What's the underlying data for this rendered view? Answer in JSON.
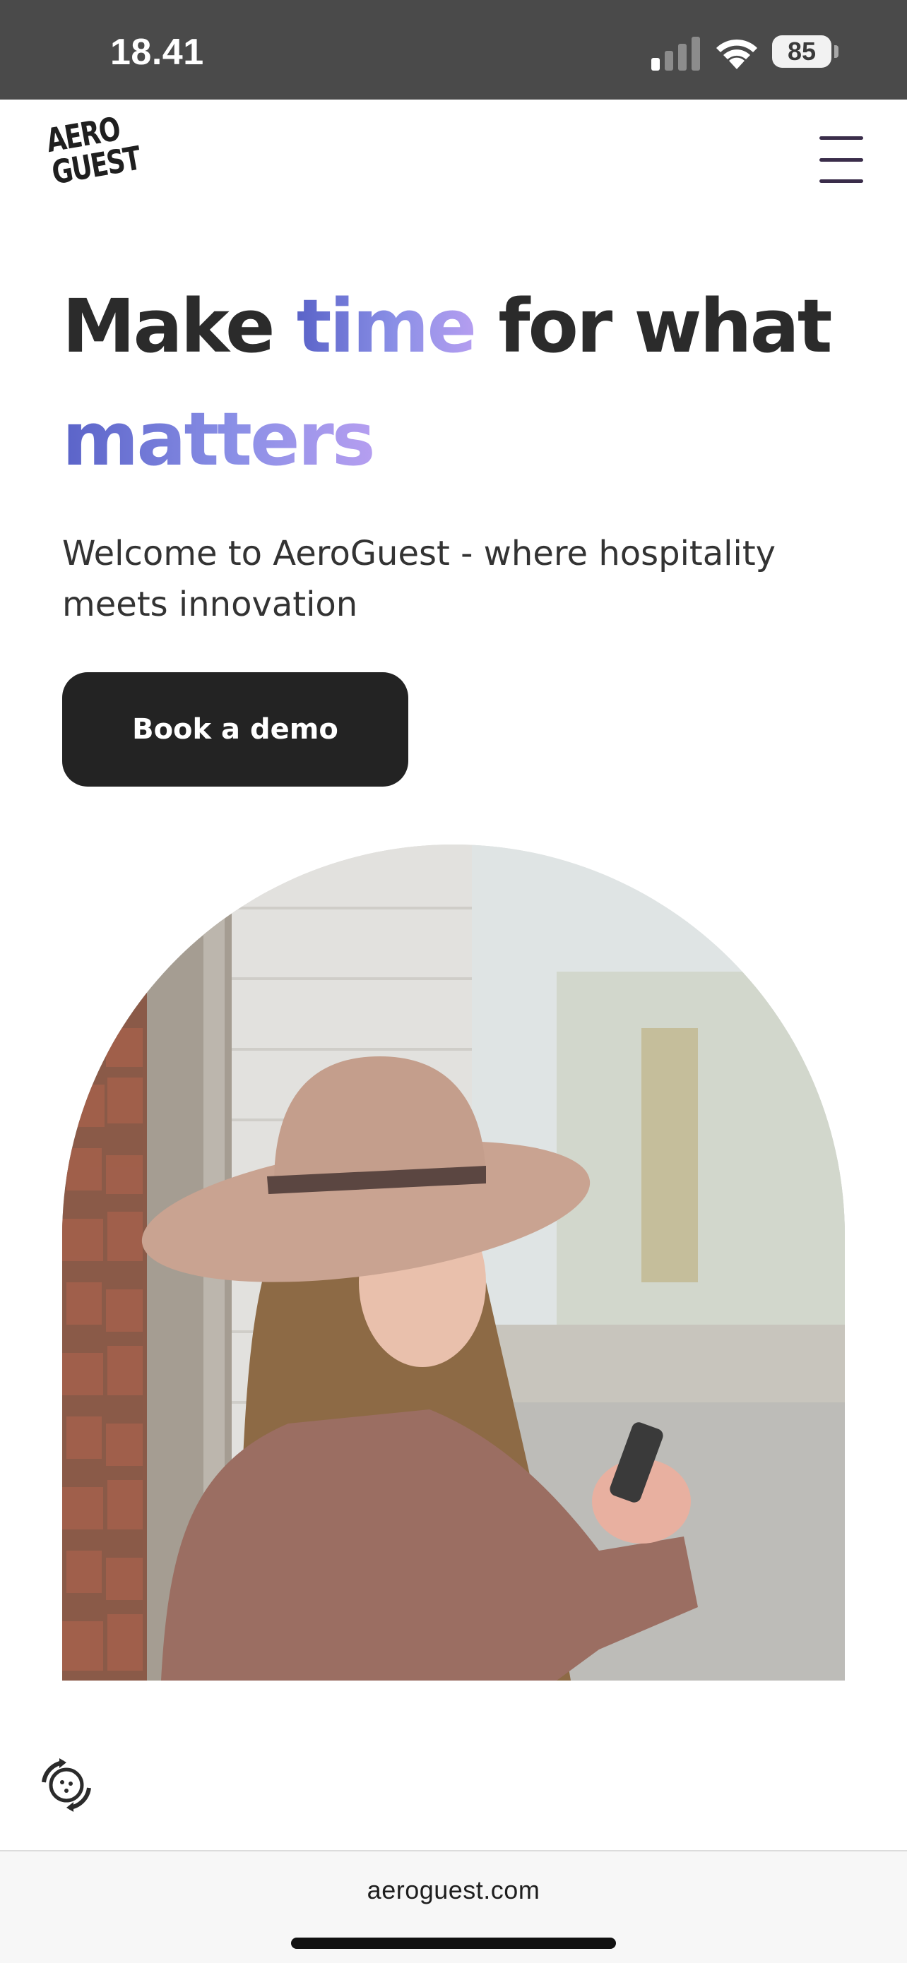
{
  "status_bar": {
    "time": "18.41",
    "battery_level": "85",
    "signal_bars_active": 1,
    "signal_bars_total": 4
  },
  "header": {
    "logo_line1": "AERO",
    "logo_line2": "GUEST",
    "menu_icon": "hamburger-menu-icon"
  },
  "hero": {
    "title_part1": "Make ",
    "title_highlight1": "time",
    "title_part2": " for what",
    "title_highlight2": "matters",
    "subtitle": "Welcome to AeroGuest - where hospitality meets innovation",
    "cta_label": "Book a demo",
    "image_description_icon": "woman-with-hat-using-phone-photo"
  },
  "widget": {
    "icon": "cookie-settings-icon"
  },
  "browser": {
    "url": "aeroguest.com"
  },
  "colors": {
    "accent_gradient_start": "#5a63c8",
    "accent_gradient_end": "#b59ef0",
    "cta_background": "#232323",
    "status_bar_background": "#4a4a4a"
  }
}
